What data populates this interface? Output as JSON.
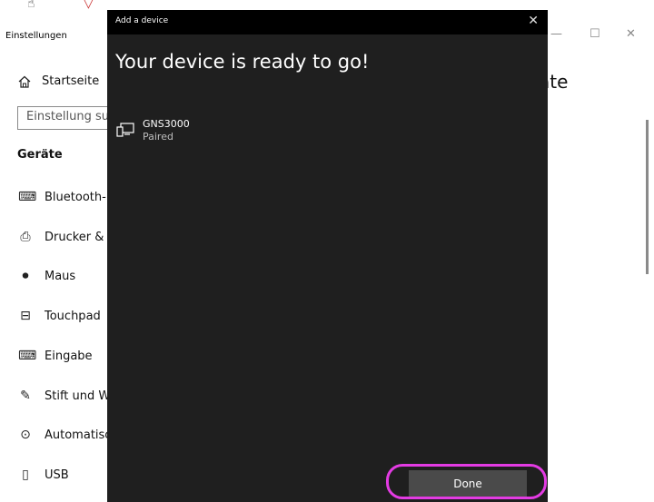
{
  "settings": {
    "title": "Einstellungen",
    "home_label": "Startseite",
    "search_placeholder": "Einstellung suc",
    "section_title": "Geräte",
    "nav_items": [
      {
        "label": "Bluetooth- u",
        "icon": "bluetooth-devices-icon"
      },
      {
        "label": "Drucker & S",
        "icon": "printer-icon"
      },
      {
        "label": "Maus",
        "icon": "mouse-icon"
      },
      {
        "label": "Touchpad",
        "icon": "touchpad-icon"
      },
      {
        "label": "Eingabe",
        "icon": "keyboard-icon"
      },
      {
        "label": "Stift und Wi",
        "icon": "pen-icon"
      },
      {
        "label": "Automatiscl",
        "icon": "autoplay-icon"
      },
      {
        "label": "USB",
        "icon": "usb-icon"
      }
    ],
    "page_title_fragment": "äte"
  },
  "dialog": {
    "title": "Add a device",
    "heading": "Your device is ready to go!",
    "device": {
      "name": "GNS3000",
      "status": "Paired"
    },
    "done_label": "Done"
  },
  "colors": {
    "dialog_bg": "#1f1f1f",
    "titlebar_bg": "#000000",
    "button_bg": "#4a4a4a",
    "highlight": "#e33be3"
  }
}
